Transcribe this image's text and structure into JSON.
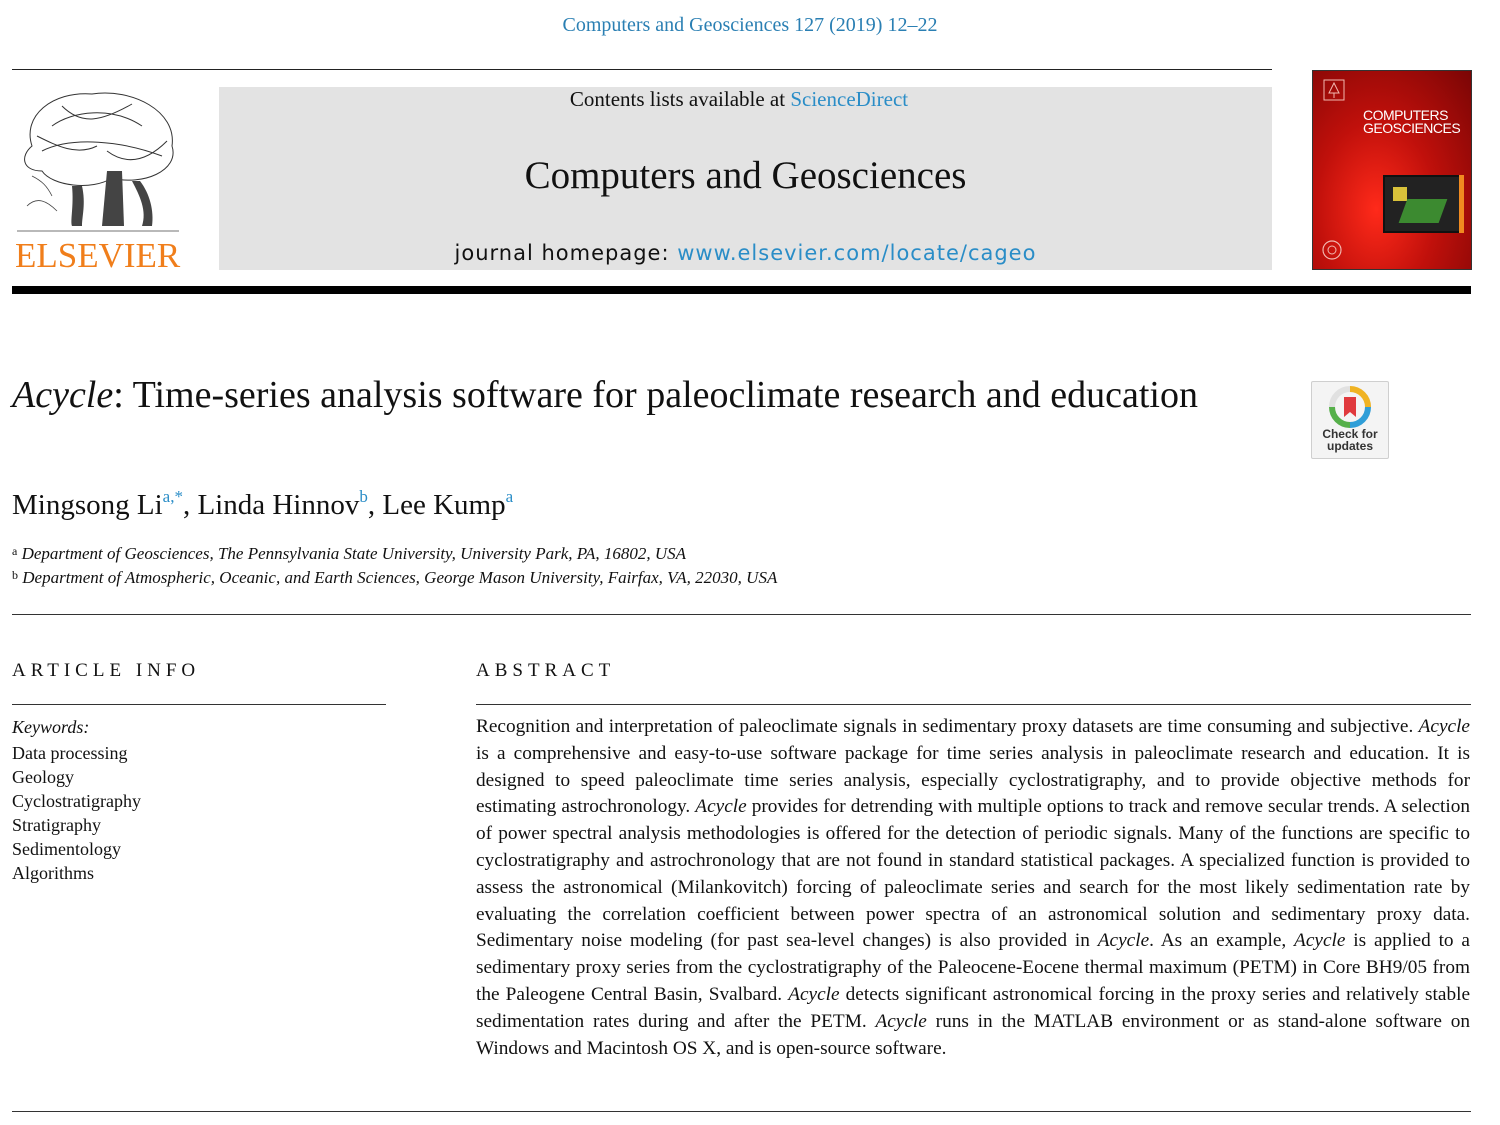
{
  "header": {
    "citation": "Computers and Geosciences 127 (2019) 12–22",
    "contents_prefix": "Contents lists available at ",
    "contents_link": "ScienceDirect",
    "journal_name": "Computers and Geosciences",
    "homepage_prefix": "journal homepage: ",
    "homepage_url": "www.elsevier.com/locate/cageo",
    "publisher": "ELSEVIER",
    "cover_title_line1": "COMPUTERS",
    "cover_title_line2": "GEOSCIENCES"
  },
  "article": {
    "title_italic": "Acycle",
    "title_rest": ": Time-series analysis software for paleoclimate research and education",
    "check_updates_line1": "Check for",
    "check_updates_line2": "updates",
    "authors": [
      {
        "name": "Mingsong Li",
        "sup": "a,*"
      },
      {
        "name": "Linda Hinnov",
        "sup": "b"
      },
      {
        "name": "Lee Kump",
        "sup": "a"
      }
    ],
    "affiliations": [
      {
        "mark": "a",
        "text": "Department of Geosciences, The Pennsylvania State University, University Park, PA, 16802, USA"
      },
      {
        "mark": "b",
        "text": "Department of Atmospheric, Oceanic, and Earth Sciences, George Mason University, Fairfax, VA, 22030, USA"
      }
    ]
  },
  "article_info": {
    "heading": "ARTICLE INFO",
    "keywords_label": "Keywords:",
    "keywords": [
      "Data processing",
      "Geology",
      "Cyclostratigraphy",
      "Stratigraphy",
      "Sedimentology",
      "Algorithms"
    ]
  },
  "abstract": {
    "heading": "ABSTRACT",
    "segments": [
      {
        "t": "Recognition and interpretation of paleoclimate signals in sedimentary proxy datasets are time consuming and subjective. "
      },
      {
        "t": "Acycle",
        "i": true
      },
      {
        "t": " is a comprehensive and easy-to-use software package for time series analysis in paleoclimate research and education. It is designed to speed paleoclimate time series analysis, especially cyclostratigraphy, and to provide objective methods for estimating astrochronology. "
      },
      {
        "t": "Acycle",
        "i": true
      },
      {
        "t": " provides for detrending with multiple options to track and remove secular trends. A selection of power spectral analysis methodologies is offered for the detection of periodic signals. Many of the functions are specific to cyclostratigraphy and astrochronology that are not found in standard statistical packages. A specialized function is provided to assess the astronomical (Milankovitch) forcing of paleoclimate series and search for the most likely sedimentation rate by evaluating the correlation coefficient between power spectra of an astronomical solution and sedimentary proxy data. Sedimentary noise modeling (for past sea-level changes) is also provided in "
      },
      {
        "t": "Acycle",
        "i": true
      },
      {
        "t": ". As an example, "
      },
      {
        "t": "Acycle",
        "i": true
      },
      {
        "t": " is applied to a sedimentary proxy series from the cyclostratigraphy of the Paleocene-Eocene thermal maximum (PETM) in Core BH9/05 from the Paleogene Central Basin, Svalbard. "
      },
      {
        "t": "Acycle",
        "i": true
      },
      {
        "t": " detects significant astronomical forcing in the proxy series and relatively stable sedimentation rates during and after the PETM. "
      },
      {
        "t": "Acycle",
        "i": true
      },
      {
        "t": " runs in the MATLAB environment or as stand-alone software on Windows and Macintosh OS X, and is open-source software."
      }
    ]
  },
  "colors": {
    "link_blue": "#2a8dc7",
    "elsevier_orange": "#f07e1b",
    "banner_gray": "#e3e3e3",
    "cover_red": "#c0100b"
  }
}
